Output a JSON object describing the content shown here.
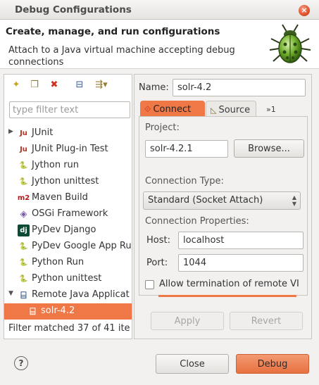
{
  "window": {
    "title": "Debug Configurations",
    "close_glyph": "×"
  },
  "header": {
    "title": "Create, manage, and run configurations",
    "description": "Attach to a Java virtual machine accepting debug connections",
    "image_icon": "bug-icon"
  },
  "toolbar": {
    "buttons": [
      {
        "name": "new-configuration-button",
        "glyph": "✦"
      },
      {
        "name": "duplicate-button",
        "glyph": "❐"
      },
      {
        "name": "delete-button",
        "glyph": "✖"
      },
      {
        "name": "collapse-all-button",
        "glyph": "⊟"
      },
      {
        "name": "filter-button",
        "glyph": "⇶▾"
      }
    ]
  },
  "filter": {
    "placeholder": "type filter text",
    "value": ""
  },
  "tree": {
    "items": [
      {
        "label": "JUnit",
        "icon": "junit-icon",
        "icon_glyph": "Ju",
        "icon_color": "#b8311e",
        "arrow": "▶"
      },
      {
        "label": "JUnit Plug-in Test",
        "icon": "junit-plugin-icon",
        "icon_glyph": "Ju",
        "icon_color": "#b8311e",
        "arrow": ""
      },
      {
        "label": "Jython run",
        "icon": "jython-icon",
        "icon_glyph": "🐍",
        "icon_color": "#2e61a8",
        "arrow": ""
      },
      {
        "label": "Jython unittest",
        "icon": "jython-unittest-icon",
        "icon_glyph": "🐍",
        "icon_color": "#2e61a8",
        "arrow": ""
      },
      {
        "label": "Maven Build",
        "icon": "maven-icon",
        "icon_glyph": "m2",
        "icon_color": "#b21a1a",
        "arrow": ""
      },
      {
        "label": "OSGi Framework",
        "icon": "osgi-icon",
        "icon_glyph": "◈",
        "icon_color": "#7a5aa8",
        "arrow": ""
      },
      {
        "label": "PyDev Django",
        "icon": "django-icon",
        "icon_glyph": "dj",
        "icon_color": "#0c4b33",
        "arrow": ""
      },
      {
        "label": "PyDev Google App Ru",
        "icon": "google-app-icon",
        "icon_glyph": "🐍",
        "icon_color": "#2e61a8",
        "arrow": ""
      },
      {
        "label": "Python Run",
        "icon": "python-run-icon",
        "icon_glyph": "🐍",
        "icon_color": "#2e61a8",
        "arrow": ""
      },
      {
        "label": "Python unittest",
        "icon": "python-unittest-icon",
        "icon_glyph": "🐍",
        "icon_color": "#2e61a8",
        "arrow": ""
      },
      {
        "label": "Remote Java Applicat",
        "icon": "remote-java-icon",
        "icon_glyph": "⌸",
        "icon_color": "#3d5a8a",
        "arrow": "▼"
      },
      {
        "label": "solr-4.2",
        "icon": "remote-config-icon",
        "icon_glyph": "⌸",
        "icon_color": "#ffffff",
        "arrow": "",
        "child": true,
        "selected": true
      }
    ],
    "status": "Filter matched 37 of 41 ite"
  },
  "config": {
    "name_label": "Name:",
    "name_value": "solr-4.2",
    "tabs": [
      {
        "label": "Connect",
        "icon": "connect-icon",
        "glyph": "⟐"
      },
      {
        "label": "Source",
        "icon": "source-icon",
        "glyph": "◺"
      },
      {
        "label": "»1",
        "icon": "more-tabs-icon",
        "glyph": ""
      }
    ],
    "project": {
      "title": "Project:",
      "value": "solr-4.2.1",
      "browse_label": "Browse..."
    },
    "connection_type": {
      "title": "Connection Type:",
      "selected": "Standard (Socket Attach)",
      "caret": "▲▼"
    },
    "connection_properties": {
      "title": "Connection Properties:",
      "host_label": "Host:",
      "host_value": "localhost",
      "port_label": "Port:",
      "port_value": "1044"
    },
    "allow_termination": {
      "label": "Allow termination of remote VI",
      "checked": false
    },
    "apply_label": "Apply",
    "revert_label": "Revert"
  },
  "footer": {
    "help_glyph": "?",
    "close_label": "Close",
    "debug_label": "Debug"
  },
  "colors": {
    "accent": "#f07746",
    "panel_bg": "#f2f1f0"
  }
}
